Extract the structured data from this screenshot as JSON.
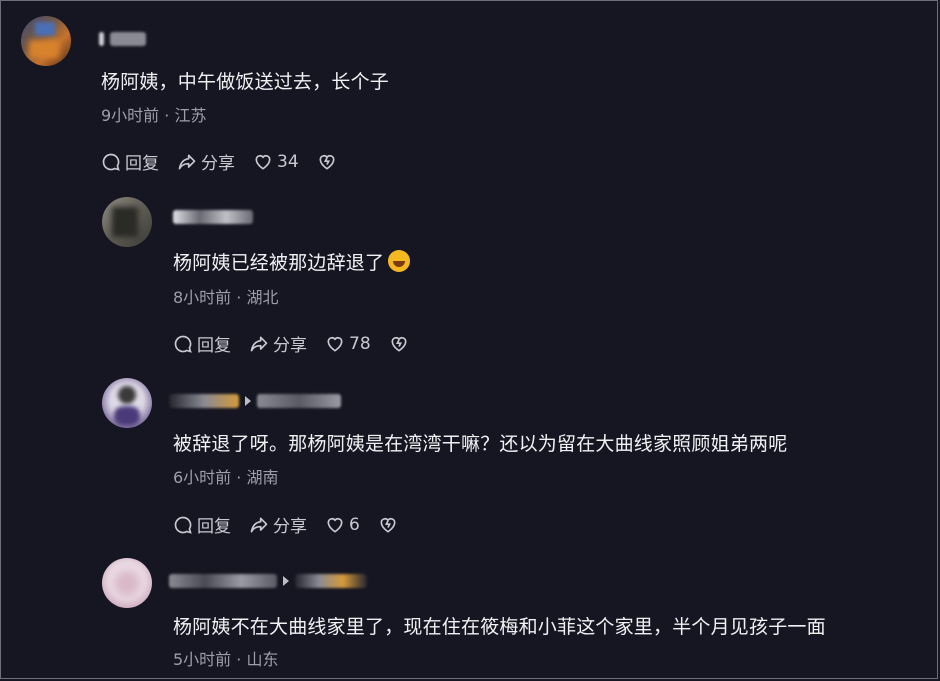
{
  "comments": [
    {
      "text": "杨阿姨，中午做饭送过去，长个子",
      "time": "9小时前",
      "location": "江苏",
      "reply_label": "回复",
      "share_label": "分享",
      "likes": "34"
    },
    {
      "text": "杨阿姨已经被那边辞退了",
      "time": "8小时前",
      "location": "湖北",
      "reply_label": "回复",
      "share_label": "分享",
      "likes": "78",
      "emoji": "rofl-emoji"
    },
    {
      "text": "被辞退了呀。那杨阿姨是在湾湾干嘛？还以为留在大曲线家照顾姐弟两呢",
      "time": "6小时前",
      "location": "湖南",
      "reply_label": "回复",
      "share_label": "分享",
      "likes": "6"
    },
    {
      "text": "杨阿姨不在大曲线家里了，现在住在筱梅和小菲这个家里，半个月见孩子一面",
      "time": "5小时前",
      "location": "山东"
    }
  ],
  "meta_separator": " · ",
  "colors": {
    "background": "#161622",
    "text": "#f1f1f4",
    "meta": "#9e9eaa"
  }
}
